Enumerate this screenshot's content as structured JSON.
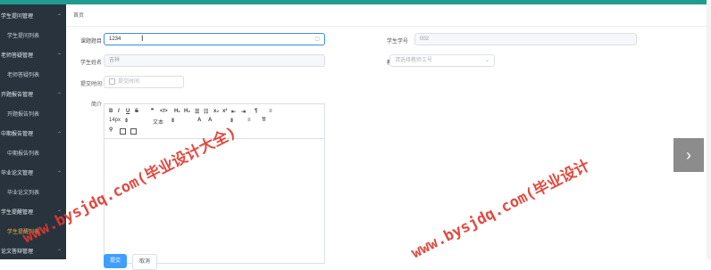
{
  "sidebar": {
    "items": [
      {
        "label": "学生提问管理",
        "kind": "group"
      },
      {
        "label": "学生提问列表",
        "kind": "sub"
      },
      {
        "label": "老师答疑管理",
        "kind": "group"
      },
      {
        "label": "老师答疑列表",
        "kind": "sub"
      },
      {
        "label": "开题报告管理",
        "kind": "group"
      },
      {
        "label": "开题报告列表",
        "kind": "sub"
      },
      {
        "label": "中期报告管理",
        "kind": "group"
      },
      {
        "label": "中期报告列表",
        "kind": "sub"
      },
      {
        "label": "毕业论文管理",
        "kind": "group"
      },
      {
        "label": "毕业论文列表",
        "kind": "sub"
      },
      {
        "label": "学生提醒管理",
        "kind": "group"
      },
      {
        "label": "学生提醒列表",
        "kind": "sub",
        "active": true
      },
      {
        "label": "论文答辩管理",
        "kind": "group"
      }
    ]
  },
  "breadcrumb": "首页",
  "form": {
    "topic_label": "课题题目",
    "topic_value": "1234",
    "student_no_label": "学生学号",
    "student_no_value": "002",
    "student_name_label": "学生姓名",
    "student_name_value": "吉祥",
    "teacher_no_label": "教师工号",
    "teacher_no_placeholder": "请选择教师工号",
    "submit_time_label": "提交时间",
    "submit_time_placeholder": "提交时间",
    "intro_label": "简介",
    "font_size": "14px",
    "text_style": "文本"
  },
  "buttons": {
    "submit": "提交",
    "cancel": "取消"
  },
  "watermark": {
    "text_a": "www.bysjdq.com(毕业设计大全)",
    "text_b": "www.bysjdq.com(毕业设计"
  },
  "colors": {
    "accent": "#1f9c8f",
    "primary": "#409eff",
    "watermark": "#e03a2f",
    "sidebar_bg": "#28333e"
  }
}
